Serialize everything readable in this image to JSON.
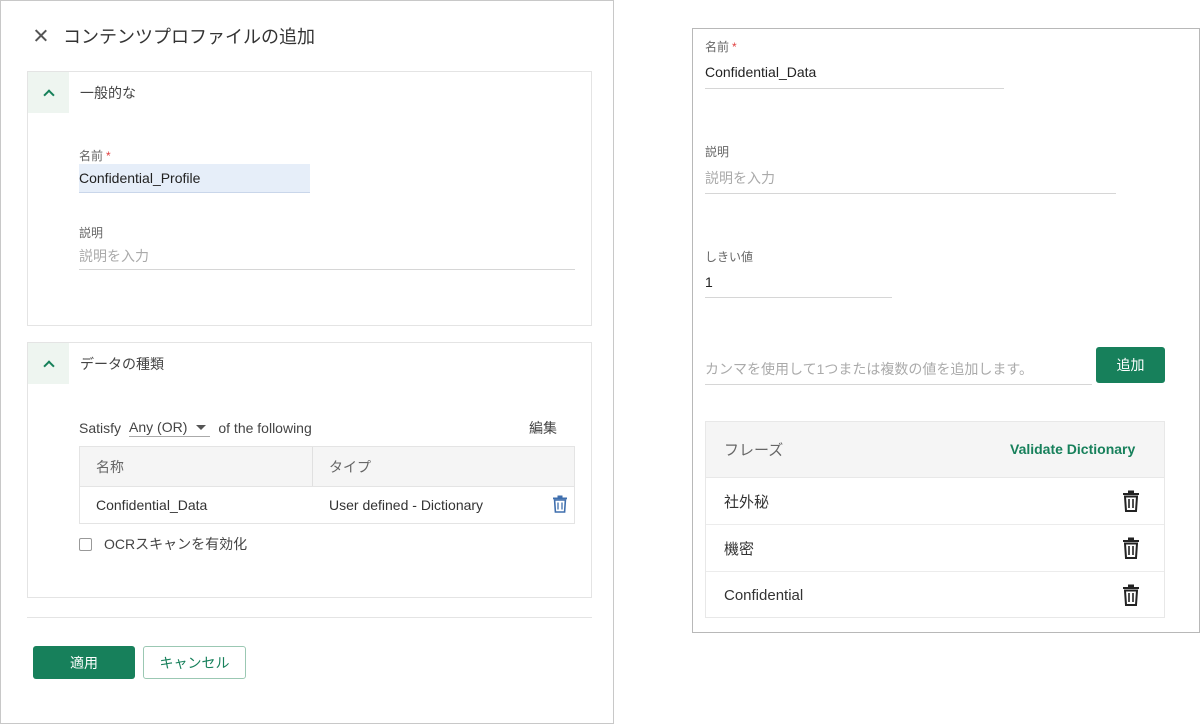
{
  "left_panel": {
    "title": "コンテンツプロファイルの追加",
    "general": {
      "section_title": "一般的な",
      "name_label": "名前",
      "required_mark": "*",
      "name_value": "Confidential_Profile",
      "description_label": "説明",
      "description_placeholder": "説明を入力"
    },
    "data_types": {
      "section_title": "データの種類",
      "satisfy_label": "Satisfy",
      "satisfy_selected": "Any (OR)",
      "of_following": "of the following",
      "edit_label": "編集",
      "table": {
        "columns": [
          "名称",
          "タイプ"
        ],
        "rows": [
          {
            "name": "Confidential_Data",
            "type": "User defined - Dictionary"
          }
        ]
      },
      "ocr_label": "OCRスキャンを有効化",
      "ocr_checked": false
    },
    "apply_label": "適用",
    "cancel_label": "キャンセル"
  },
  "right_panel": {
    "name_label": "名前",
    "required_mark": "*",
    "name_value": "Confidential_Data",
    "description_label": "説明",
    "description_placeholder": "説明を入力",
    "threshold_label": "しきい値",
    "threshold_value": "1",
    "add_placeholder": "カンマを使用して1つまたは複数の値を追加します。",
    "add_label": "追加",
    "phrase_header": "フレーズ",
    "validate_label": "Validate Dictionary",
    "phrases": [
      "社外秘",
      "機密",
      "Confidential"
    ]
  },
  "colors": {
    "accent": "#17805b",
    "required": "#e04040",
    "name_field_bg": "#e6eef9",
    "trash_blue": "#3f6fae"
  }
}
